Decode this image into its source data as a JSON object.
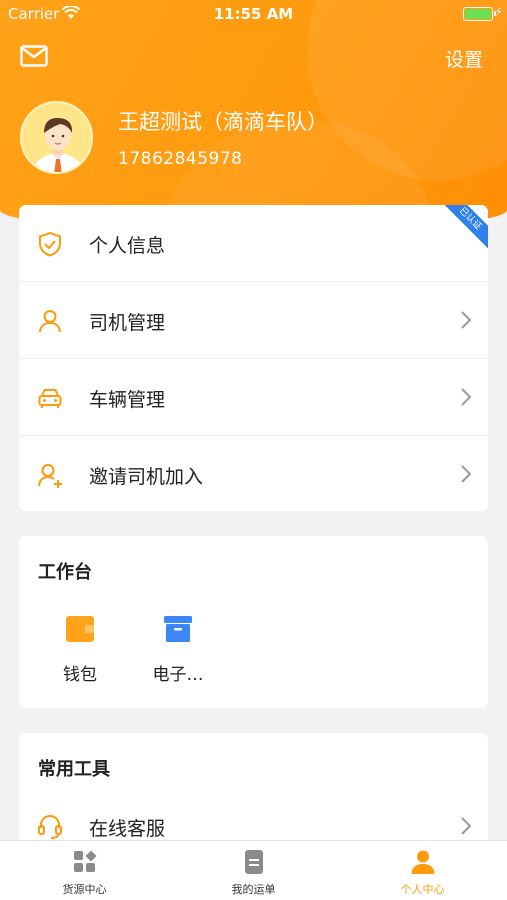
{
  "status_bar": {
    "carrier": "Carrier",
    "time": "11:55 AM"
  },
  "header": {
    "settings_label": "设置"
  },
  "user": {
    "name": "王超测试（滴滴车队）",
    "phone": "17862845978"
  },
  "verified_badge": "已认证",
  "menu": [
    {
      "label": "个人信息",
      "icon": "shield-check-icon"
    },
    {
      "label": "司机管理",
      "icon": "person-icon"
    },
    {
      "label": "车辆管理",
      "icon": "car-icon"
    },
    {
      "label": "邀请司机加入",
      "icon": "add-person-icon"
    }
  ],
  "workbench": {
    "title": "工作台",
    "items": [
      {
        "label": "钱包",
        "icon": "wallet-icon"
      },
      {
        "label": "电子…",
        "icon": "archive-box-icon"
      }
    ]
  },
  "tools": {
    "title": "常用工具",
    "items": [
      {
        "label": "在线客服",
        "icon": "headset-icon"
      }
    ]
  },
  "tabbar": [
    {
      "label": "货源中心",
      "icon": "grid-icon"
    },
    {
      "label": "我的运单",
      "icon": "document-icon"
    },
    {
      "label": "个人中心",
      "icon": "person-icon"
    }
  ],
  "colors": {
    "accent": "#ff9a0d",
    "tab_inactive": "#333333",
    "wallet": "#ffa31a",
    "archive": "#3d86f5",
    "badge": "#2f80ed"
  }
}
